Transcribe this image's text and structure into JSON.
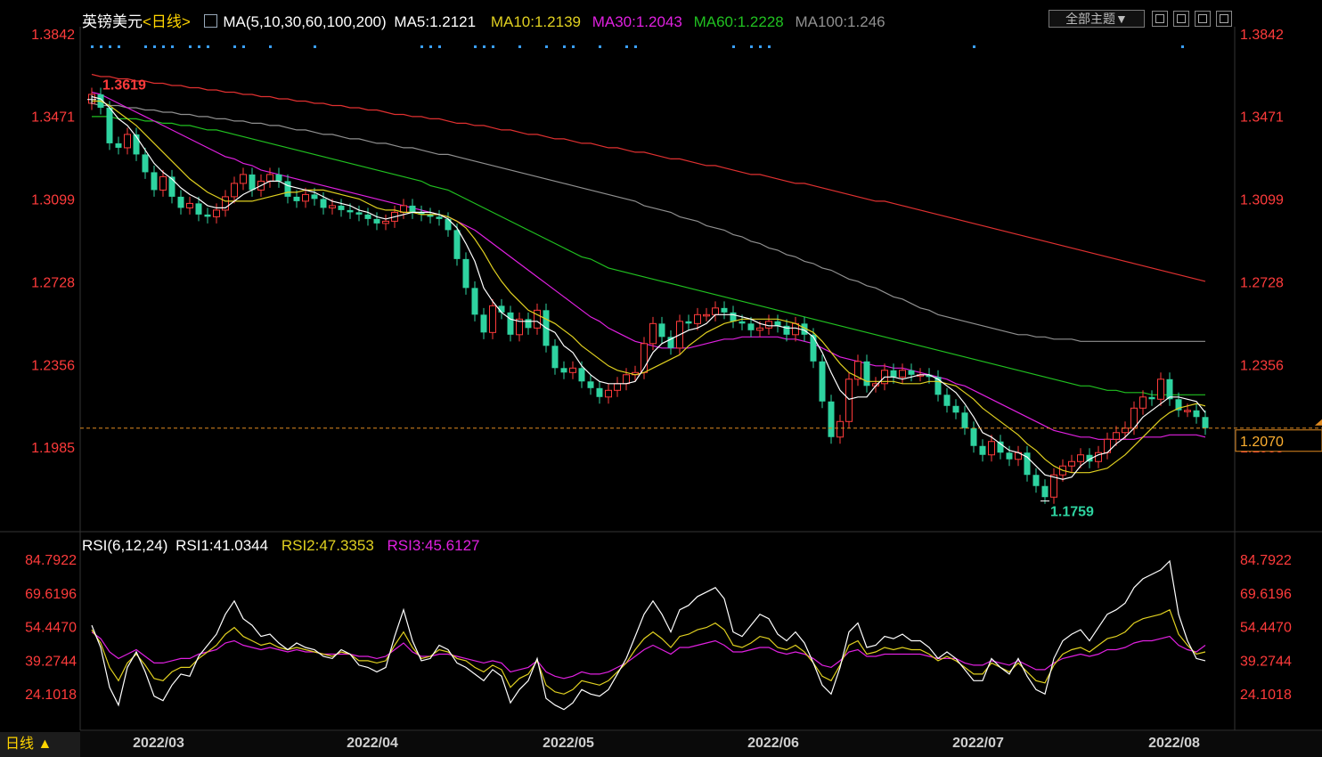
{
  "header": {
    "symbol": "英镑美元",
    "period": "<日线>",
    "ma_params": "MA(5,10,30,60,100,200)",
    "ma5": "MA5:1.2121",
    "ma10": "MA10:1.2139",
    "ma30": "MA30:1.2043",
    "ma60": "MA60:1.2228",
    "ma100": "MA100:1.246",
    "theme_button": "全部主题▼"
  },
  "rsi_header": {
    "params": "RSI(6,12,24)",
    "rsi1": "RSI1:41.0344",
    "rsi2": "RSI2:47.3353",
    "rsi3": "RSI3:45.6127"
  },
  "footer": {
    "period_label": "日线 ▲"
  },
  "colors": {
    "up": "#ff3b3b",
    "down": "#2ed3a0",
    "ma5": "#ffffff",
    "ma10": "#e0d020",
    "ma30": "#e020e0",
    "ma60": "#20c020",
    "ma100": "#909090",
    "ma200": "#e03030",
    "axis": "#ff3b3b",
    "grid": "#333333"
  },
  "chart_data": [
    {
      "type": "candlestick",
      "title": "英镑美元",
      "y_ticks": [
        "1.3842",
        "1.3471",
        "1.3099",
        "1.2728",
        "1.2356",
        "1.1985"
      ],
      "ylim": [
        1.172,
        1.3842
      ],
      "x_ticks": [
        "2022/03",
        "2022/04",
        "2022/05",
        "2022/06",
        "2022/07",
        "2022/08"
      ],
      "x_tick_index": [
        3,
        27,
        49,
        72,
        95,
        117
      ],
      "high_label": "1.3619",
      "low_label": "1.1759",
      "high_index": 0,
      "low_index": 107,
      "current_price": "1.2070",
      "close": [
        1.357,
        1.351,
        1.335,
        1.333,
        1.339,
        1.33,
        1.322,
        1.314,
        1.32,
        1.311,
        1.306,
        1.308,
        1.303,
        1.302,
        1.305,
        1.311,
        1.317,
        1.321,
        1.314,
        1.318,
        1.321,
        1.318,
        1.311,
        1.309,
        1.312,
        1.31,
        1.306,
        1.307,
        1.305,
        1.304,
        1.303,
        1.301,
        1.299,
        1.3,
        1.304,
        1.307,
        1.304,
        1.303,
        1.302,
        1.301,
        1.296,
        1.283,
        1.27,
        1.258,
        1.25,
        1.262,
        1.259,
        1.249,
        1.256,
        1.252,
        1.26,
        1.244,
        1.234,
        1.232,
        1.234,
        1.228,
        1.225,
        1.221,
        1.224,
        1.227,
        1.231,
        1.232,
        1.245,
        1.254,
        1.248,
        1.243,
        1.255,
        1.254,
        1.258,
        1.258,
        1.261,
        1.259,
        1.255,
        1.254,
        1.251,
        1.252,
        1.255,
        1.253,
        1.249,
        1.254,
        1.249,
        1.237,
        1.219,
        1.203,
        1.21,
        1.229,
        1.237,
        1.226,
        1.227,
        1.233,
        1.23,
        1.233,
        1.231,
        1.231,
        1.23,
        1.222,
        1.217,
        1.214,
        1.207,
        1.199,
        1.195,
        1.201,
        1.196,
        1.193,
        1.196,
        1.186,
        1.181,
        1.176,
        1.186,
        1.19,
        1.192,
        1.195,
        1.192,
        1.196,
        1.202,
        1.205,
        1.207,
        1.216,
        1.221,
        1.22,
        1.229,
        1.22,
        1.215,
        1.215,
        1.212,
        1.207
      ],
      "ma5": [
        1.356,
        1.355,
        1.351,
        1.346,
        1.343,
        1.338,
        1.332,
        1.326,
        1.322,
        1.319,
        1.315,
        1.312,
        1.31,
        1.307,
        1.306,
        1.306,
        1.309,
        1.312,
        1.314,
        1.316,
        1.318,
        1.318,
        1.316,
        1.315,
        1.314,
        1.313,
        1.311,
        1.309,
        1.308,
        1.307,
        1.305,
        1.304,
        1.302,
        1.301,
        1.302,
        1.303,
        1.304,
        1.304,
        1.304,
        1.303,
        1.301,
        1.297,
        1.29,
        1.282,
        1.27,
        1.264,
        1.259,
        1.256,
        1.255,
        1.255,
        1.255,
        1.252,
        1.25,
        1.244,
        1.241,
        1.235,
        1.231,
        1.228,
        1.227,
        1.227,
        1.227,
        1.228,
        1.234,
        1.241,
        1.245,
        1.247,
        1.249,
        1.251,
        1.252,
        1.254,
        1.258,
        1.258,
        1.258,
        1.257,
        1.256,
        1.254,
        1.253,
        1.253,
        1.252,
        1.252,
        1.251,
        1.248,
        1.241,
        1.232,
        1.224,
        1.22,
        1.221,
        1.221,
        1.226,
        1.23,
        1.23,
        1.229,
        1.23,
        1.231,
        1.231,
        1.229,
        1.226,
        1.223,
        1.218,
        1.212,
        1.205,
        1.203,
        1.2,
        1.197,
        1.196,
        1.194,
        1.19,
        1.186,
        1.185,
        1.184,
        1.185,
        1.19,
        1.193,
        1.195,
        1.196,
        1.2,
        1.203,
        1.207,
        1.212,
        1.215,
        1.218,
        1.221,
        1.221,
        1.22,
        1.219,
        1.214
      ],
      "ma10": [
        1.354,
        1.354,
        1.352,
        1.349,
        1.346,
        1.343,
        1.339,
        1.335,
        1.331,
        1.327,
        1.323,
        1.319,
        1.316,
        1.313,
        1.311,
        1.309,
        1.309,
        1.309,
        1.309,
        1.31,
        1.311,
        1.312,
        1.313,
        1.313,
        1.314,
        1.314,
        1.314,
        1.313,
        1.312,
        1.311,
        1.31,
        1.308,
        1.306,
        1.305,
        1.305,
        1.304,
        1.304,
        1.303,
        1.303,
        1.303,
        1.302,
        1.3,
        1.297,
        1.292,
        1.286,
        1.279,
        1.273,
        1.268,
        1.264,
        1.26,
        1.258,
        1.256,
        1.254,
        1.251,
        1.248,
        1.244,
        1.241,
        1.238,
        1.235,
        1.233,
        1.232,
        1.231,
        1.232,
        1.234,
        1.236,
        1.238,
        1.24,
        1.244,
        1.247,
        1.25,
        1.252,
        1.254,
        1.255,
        1.256,
        1.256,
        1.256,
        1.256,
        1.256,
        1.255,
        1.254,
        1.252,
        1.25,
        1.246,
        1.241,
        1.236,
        1.232,
        1.23,
        1.228,
        1.228,
        1.228,
        1.228,
        1.227,
        1.227,
        1.227,
        1.228,
        1.228,
        1.227,
        1.226,
        1.223,
        1.22,
        1.216,
        1.213,
        1.21,
        1.207,
        1.204,
        1.2,
        1.197,
        1.193,
        1.19,
        1.188,
        1.187,
        1.187,
        1.187,
        1.188,
        1.189,
        1.192,
        1.195,
        1.199,
        1.203,
        1.207,
        1.211,
        1.214,
        1.216,
        1.217,
        1.218,
        1.217
      ],
      "ma30": [
        1.358,
        1.357,
        1.355,
        1.353,
        1.351,
        1.349,
        1.347,
        1.345,
        1.343,
        1.341,
        1.339,
        1.337,
        1.335,
        1.333,
        1.331,
        1.329,
        1.328,
        1.326,
        1.325,
        1.323,
        1.322,
        1.321,
        1.32,
        1.319,
        1.318,
        1.317,
        1.316,
        1.315,
        1.314,
        1.313,
        1.312,
        1.311,
        1.31,
        1.309,
        1.308,
        1.307,
        1.306,
        1.305,
        1.304,
        1.303,
        1.302,
        1.3,
        1.298,
        1.296,
        1.293,
        1.29,
        1.287,
        1.284,
        1.281,
        1.278,
        1.275,
        1.272,
        1.269,
        1.266,
        1.263,
        1.26,
        1.257,
        1.255,
        1.252,
        1.25,
        1.248,
        1.246,
        1.245,
        1.244,
        1.243,
        1.243,
        1.243,
        1.243,
        1.244,
        1.245,
        1.246,
        1.247,
        1.247,
        1.248,
        1.248,
        1.248,
        1.248,
        1.248,
        1.247,
        1.247,
        1.246,
        1.245,
        1.243,
        1.241,
        1.239,
        1.238,
        1.237,
        1.236,
        1.235,
        1.235,
        1.234,
        1.234,
        1.233,
        1.232,
        1.231,
        1.23,
        1.229,
        1.227,
        1.226,
        1.224,
        1.222,
        1.22,
        1.218,
        1.216,
        1.214,
        1.212,
        1.21,
        1.208,
        1.206,
        1.205,
        1.204,
        1.203,
        1.203,
        1.202,
        1.202,
        1.202,
        1.202,
        1.202,
        1.203,
        1.203,
        1.203,
        1.204,
        1.204,
        1.204,
        1.204,
        1.203
      ],
      "ma60": [
        1.347,
        1.347,
        1.347,
        1.346,
        1.346,
        1.346,
        1.345,
        1.345,
        1.344,
        1.344,
        1.343,
        1.343,
        1.342,
        1.341,
        1.341,
        1.34,
        1.339,
        1.338,
        1.337,
        1.336,
        1.335,
        1.334,
        1.333,
        1.332,
        1.331,
        1.33,
        1.329,
        1.328,
        1.327,
        1.326,
        1.325,
        1.324,
        1.323,
        1.322,
        1.321,
        1.32,
        1.319,
        1.318,
        1.316,
        1.315,
        1.314,
        1.312,
        1.31,
        1.308,
        1.306,
        1.304,
        1.302,
        1.3,
        1.298,
        1.296,
        1.294,
        1.292,
        1.29,
        1.288,
        1.286,
        1.284,
        1.283,
        1.281,
        1.279,
        1.278,
        1.277,
        1.276,
        1.275,
        1.274,
        1.273,
        1.272,
        1.271,
        1.27,
        1.269,
        1.268,
        1.267,
        1.266,
        1.265,
        1.264,
        1.263,
        1.262,
        1.261,
        1.26,
        1.259,
        1.258,
        1.257,
        1.256,
        1.255,
        1.254,
        1.253,
        1.252,
        1.251,
        1.25,
        1.249,
        1.248,
        1.247,
        1.246,
        1.245,
        1.244,
        1.243,
        1.242,
        1.241,
        1.24,
        1.239,
        1.238,
        1.237,
        1.236,
        1.235,
        1.234,
        1.233,
        1.232,
        1.231,
        1.23,
        1.229,
        1.228,
        1.227,
        1.226,
        1.226,
        1.225,
        1.224,
        1.224,
        1.223,
        1.223,
        1.223,
        1.222,
        1.222,
        1.222,
        1.222,
        1.222,
        1.222,
        1.222
      ],
      "ma100": [
        1.353,
        1.352,
        1.352,
        1.352,
        1.351,
        1.351,
        1.35,
        1.35,
        1.349,
        1.349,
        1.348,
        1.348,
        1.347,
        1.347,
        1.346,
        1.346,
        1.345,
        1.345,
        1.344,
        1.344,
        1.343,
        1.343,
        1.342,
        1.341,
        1.341,
        1.34,
        1.339,
        1.339,
        1.338,
        1.337,
        1.337,
        1.336,
        1.335,
        1.335,
        1.334,
        1.333,
        1.333,
        1.332,
        1.331,
        1.33,
        1.33,
        1.329,
        1.328,
        1.327,
        1.326,
        1.325,
        1.324,
        1.323,
        1.322,
        1.321,
        1.32,
        1.319,
        1.318,
        1.317,
        1.316,
        1.315,
        1.314,
        1.313,
        1.312,
        1.311,
        1.31,
        1.309,
        1.307,
        1.306,
        1.305,
        1.304,
        1.302,
        1.301,
        1.3,
        1.298,
        1.297,
        1.296,
        1.294,
        1.293,
        1.291,
        1.29,
        1.288,
        1.287,
        1.285,
        1.284,
        1.282,
        1.281,
        1.279,
        1.278,
        1.276,
        1.274,
        1.273,
        1.271,
        1.27,
        1.268,
        1.266,
        1.265,
        1.263,
        1.261,
        1.26,
        1.258,
        1.257,
        1.256,
        1.255,
        1.254,
        1.253,
        1.252,
        1.251,
        1.25,
        1.249,
        1.249,
        1.248,
        1.248,
        1.247,
        1.247,
        1.247,
        1.246,
        1.246,
        1.246,
        1.246,
        1.246,
        1.246,
        1.246,
        1.246,
        1.246,
        1.246,
        1.246,
        1.246,
        1.246,
        1.246,
        1.246
      ],
      "ma200": [
        1.366,
        1.365,
        1.365,
        1.364,
        1.364,
        1.363,
        1.363,
        1.362,
        1.362,
        1.361,
        1.361,
        1.36,
        1.36,
        1.359,
        1.359,
        1.358,
        1.358,
        1.357,
        1.357,
        1.356,
        1.356,
        1.355,
        1.355,
        1.354,
        1.354,
        1.353,
        1.353,
        1.352,
        1.352,
        1.351,
        1.351,
        1.35,
        1.35,
        1.349,
        1.348,
        1.348,
        1.347,
        1.347,
        1.346,
        1.346,
        1.345,
        1.344,
        1.344,
        1.343,
        1.343,
        1.342,
        1.341,
        1.341,
        1.34,
        1.339,
        1.339,
        1.338,
        1.337,
        1.337,
        1.336,
        1.335,
        1.335,
        1.334,
        1.333,
        1.333,
        1.332,
        1.331,
        1.331,
        1.33,
        1.329,
        1.328,
        1.328,
        1.327,
        1.326,
        1.325,
        1.325,
        1.324,
        1.323,
        1.322,
        1.321,
        1.321,
        1.32,
        1.319,
        1.318,
        1.317,
        1.317,
        1.316,
        1.315,
        1.314,
        1.313,
        1.312,
        1.311,
        1.31,
        1.309,
        1.309,
        1.308,
        1.307,
        1.306,
        1.305,
        1.304,
        1.303,
        1.302,
        1.301,
        1.3,
        1.299,
        1.298,
        1.297,
        1.296,
        1.295,
        1.294,
        1.293,
        1.292,
        1.291,
        1.29,
        1.289,
        1.288,
        1.287,
        1.286,
        1.285,
        1.284,
        1.283,
        1.282,
        1.281,
        1.28,
        1.279,
        1.278,
        1.277,
        1.276,
        1.275,
        1.274,
        1.273
      ]
    },
    {
      "type": "line",
      "title": "RSI(6,12,24)",
      "y_ticks": [
        "84.7922",
        "69.6196",
        "54.4470",
        "39.2744",
        "24.1018"
      ],
      "ylim": [
        9.0,
        90.0
      ],
      "rsi1": [
        55,
        45,
        27,
        19,
        36,
        43,
        34,
        23,
        21,
        28,
        33,
        32,
        41,
        46,
        51,
        60,
        66,
        58,
        55,
        50,
        51,
        47,
        44,
        47,
        45,
        44,
        41,
        40,
        44,
        42,
        37,
        36,
        34,
        36,
        50,
        62,
        48,
        39,
        40,
        46,
        44,
        38,
        36,
        33,
        30,
        35,
        32,
        20,
        26,
        30,
        40,
        22,
        19,
        17,
        20,
        26,
        24,
        23,
        26,
        33,
        40,
        50,
        60,
        66,
        60,
        52,
        62,
        64,
        68,
        70,
        72,
        67,
        52,
        50,
        55,
        60,
        58,
        51,
        48,
        52,
        47,
        38,
        28,
        24,
        36,
        52,
        56,
        45,
        46,
        50,
        49,
        51,
        48,
        48,
        45,
        40,
        43,
        40,
        35,
        30,
        30,
        40,
        36,
        33,
        40,
        32,
        26,
        24,
        40,
        48,
        51,
        53,
        48,
        54,
        60,
        62,
        65,
        72,
        76,
        78,
        80,
        84,
        60,
        48,
        40,
        39
      ],
      "rsi2": [
        53,
        47,
        36,
        30,
        38,
        42,
        37,
        31,
        30,
        34,
        36,
        36,
        40,
        43,
        46,
        51,
        54,
        50,
        48,
        46,
        47,
        45,
        44,
        45,
        44,
        43,
        42,
        41,
        43,
        42,
        39,
        39,
        38,
        39,
        46,
        52,
        45,
        40,
        41,
        44,
        43,
        40,
        39,
        36,
        34,
        37,
        35,
        27,
        31,
        33,
        39,
        28,
        25,
        24,
        26,
        30,
        29,
        28,
        30,
        34,
        38,
        44,
        49,
        52,
        49,
        45,
        50,
        51,
        53,
        54,
        56,
        53,
        46,
        45,
        47,
        50,
        49,
        45,
        44,
        46,
        43,
        38,
        32,
        30,
        37,
        46,
        48,
        42,
        43,
        45,
        44,
        45,
        44,
        44,
        42,
        39,
        41,
        39,
        36,
        33,
        33,
        38,
        36,
        34,
        38,
        34,
        30,
        29,
        37,
        42,
        44,
        45,
        43,
        46,
        49,
        50,
        52,
        56,
        58,
        59,
        60,
        62,
        51,
        46,
        42,
        43
      ],
      "rsi3": [
        52,
        49,
        43,
        40,
        42,
        44,
        41,
        38,
        38,
        39,
        40,
        40,
        42,
        43,
        44,
        47,
        48,
        46,
        45,
        44,
        45,
        44,
        43,
        44,
        43,
        43,
        42,
        42,
        42,
        42,
        41,
        41,
        40,
        41,
        44,
        47,
        43,
        41,
        41,
        42,
        42,
        41,
        40,
        39,
        38,
        39,
        38,
        34,
        35,
        36,
        39,
        34,
        32,
        31,
        32,
        34,
        33,
        33,
        34,
        36,
        38,
        41,
        44,
        46,
        44,
        42,
        45,
        45,
        46,
        47,
        48,
        46,
        43,
        43,
        44,
        45,
        45,
        43,
        42,
        43,
        42,
        40,
        37,
        36,
        39,
        43,
        44,
        41,
        41,
        42,
        42,
        42,
        42,
        42,
        41,
        40,
        40,
        40,
        38,
        37,
        37,
        39,
        38,
        37,
        39,
        37,
        35,
        35,
        38,
        40,
        41,
        42,
        41,
        42,
        44,
        44,
        45,
        47,
        48,
        48,
        49,
        50,
        46,
        44,
        43,
        46
      ]
    }
  ]
}
